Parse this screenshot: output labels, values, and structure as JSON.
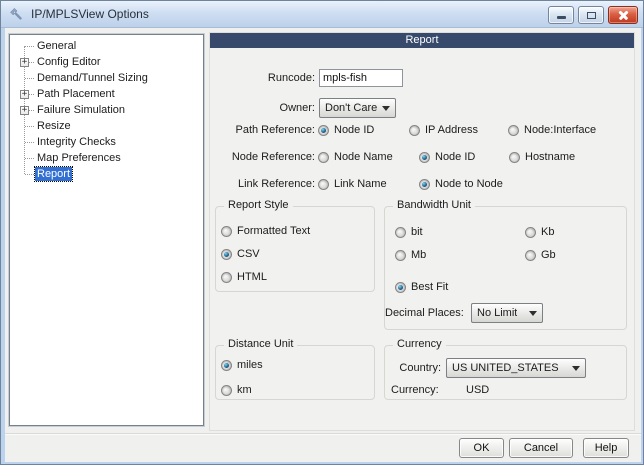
{
  "window": {
    "title": "IP/MPLSView Options"
  },
  "sidebar": {
    "items": [
      {
        "label": "General",
        "expandable": false,
        "selected": false
      },
      {
        "label": "Config Editor",
        "expandable": true,
        "selected": false
      },
      {
        "label": "Demand/Tunnel Sizing",
        "expandable": false,
        "selected": false
      },
      {
        "label": "Path Placement",
        "expandable": true,
        "selected": false
      },
      {
        "label": "Failure Simulation",
        "expandable": true,
        "selected": false
      },
      {
        "label": "Resize",
        "expandable": false,
        "selected": false
      },
      {
        "label": "Integrity Checks",
        "expandable": false,
        "selected": false
      },
      {
        "label": "Map Preferences",
        "expandable": false,
        "selected": false
      },
      {
        "label": "Report",
        "expandable": false,
        "selected": true
      }
    ],
    "expander_glyph": "+"
  },
  "panel": {
    "header": "Report",
    "fields": {
      "runcode_label": "Runcode:",
      "runcode_value": "mpls-fish",
      "owner_label": "Owner:",
      "owner_value": "Don't Care"
    },
    "references": {
      "path": {
        "label": "Path Reference:",
        "options": [
          "Node ID",
          "IP Address",
          "Node:Interface"
        ],
        "selected": "Node ID"
      },
      "node": {
        "label": "Node Reference:",
        "options": [
          "Node Name",
          "Node ID",
          "Hostname"
        ],
        "selected": "Node ID"
      },
      "link": {
        "label": "Link Reference:",
        "options": [
          "Link Name",
          "Node to Node"
        ],
        "selected": "Node to Node"
      }
    },
    "report_style": {
      "title": "Report Style",
      "options": [
        "Formatted Text",
        "CSV",
        "HTML"
      ],
      "selected": "CSV"
    },
    "bandwidth_unit": {
      "title": "Bandwidth Unit",
      "options": [
        "bit",
        "Kb",
        "Mb",
        "Gb",
        "Best Fit"
      ],
      "selected": "Best Fit",
      "decimal_label": "Decimal Places:",
      "decimal_value": "No Limit"
    },
    "distance_unit": {
      "title": "Distance Unit",
      "options": [
        "miles",
        "km"
      ],
      "selected": "miles"
    },
    "currency": {
      "title": "Currency",
      "country_label": "Country:",
      "country_value": "US UNITED_STATES",
      "currency_label": "Currency:",
      "currency_value": "USD"
    }
  },
  "footer": {
    "ok": "OK",
    "cancel": "Cancel",
    "help": "Help"
  },
  "colors": {
    "selection": "#3370d4",
    "panel_header": "#374a6b",
    "close_red": "#bd3a21"
  }
}
